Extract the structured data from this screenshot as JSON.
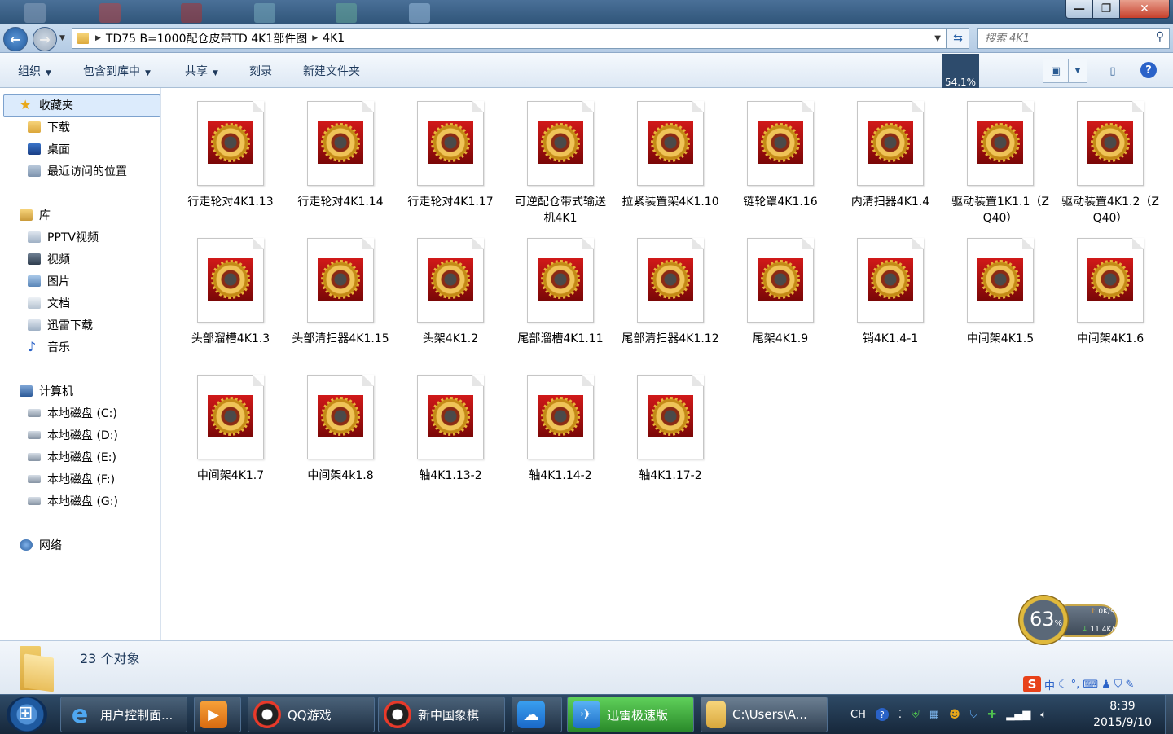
{
  "window": {
    "minimize": "—",
    "maximize": "❐",
    "close": "✕"
  },
  "address": {
    "segments": [
      "TD75 B=1000配仓皮带TD 4K1部件图",
      "4K1"
    ]
  },
  "search": {
    "placeholder": "搜索 4K1"
  },
  "toolbar": {
    "organize": "组织",
    "include_in_library": "包含到库中",
    "share": "共享",
    "burn": "刻录",
    "new_folder": "新建文件夹",
    "zoom_tooltip": "54.1%"
  },
  "nav": {
    "favorites": {
      "label": "收藏夹",
      "items": [
        "下载",
        "桌面",
        "最近访问的位置"
      ]
    },
    "libraries": {
      "label": "库",
      "items": [
        "PPTV视频",
        "视频",
        "图片",
        "文档",
        "迅雷下载",
        "音乐"
      ]
    },
    "computer": {
      "label": "计算机",
      "items": [
        "本地磁盘 (C:)",
        "本地磁盘 (D:)",
        "本地磁盘 (E:)",
        "本地磁盘 (F:)",
        "本地磁盘 (G:)"
      ]
    },
    "network": {
      "label": "网络"
    }
  },
  "files": [
    "行走轮对4K1.13",
    "行走轮对4K1.14",
    "行走轮对4K1.17",
    "可逆配仓带式输送机4K1",
    "拉紧装置架4K1.10",
    "链轮罩4K1.16",
    "内清扫器4K1.4",
    "驱动装置1K1.1（ZQ40）",
    "驱动装置4K1.2（ZQ40）",
    "头部溜槽4K1.3",
    "头部清扫器4K1.15",
    "头架4K1.2",
    "尾部溜槽4K1.11",
    "尾部清扫器4K1.12",
    "尾架4K1.9",
    "销4K1.4-1",
    "中间架4K1.5",
    "中间架4K1.6",
    "中间架4K1.7",
    "中间架4k1.8",
    "轴4K1.13-2",
    "轴4K1.14-2",
    "轴4K1.17-2"
  ],
  "status": {
    "count": "23 个对象"
  },
  "speed_widget": {
    "percent": "63",
    "percent_sign": "%",
    "upload": "0K/s",
    "download": "11.4K/s"
  },
  "ime": {
    "logo": "S",
    "lang": "中"
  },
  "taskbar": {
    "items": [
      "用户控制面...",
      "",
      "QQ游戏",
      "新中国象棋",
      "",
      "迅雷极速版",
      "C:\\Users\\A..."
    ],
    "tray_lang": "CH",
    "time": "8:39",
    "date": "2015/9/10"
  },
  "colors": {
    "accent": "#2a62c8",
    "selection": "#dcebfc",
    "gear_red": "#c01212",
    "gear_gold": "#efc357"
  }
}
